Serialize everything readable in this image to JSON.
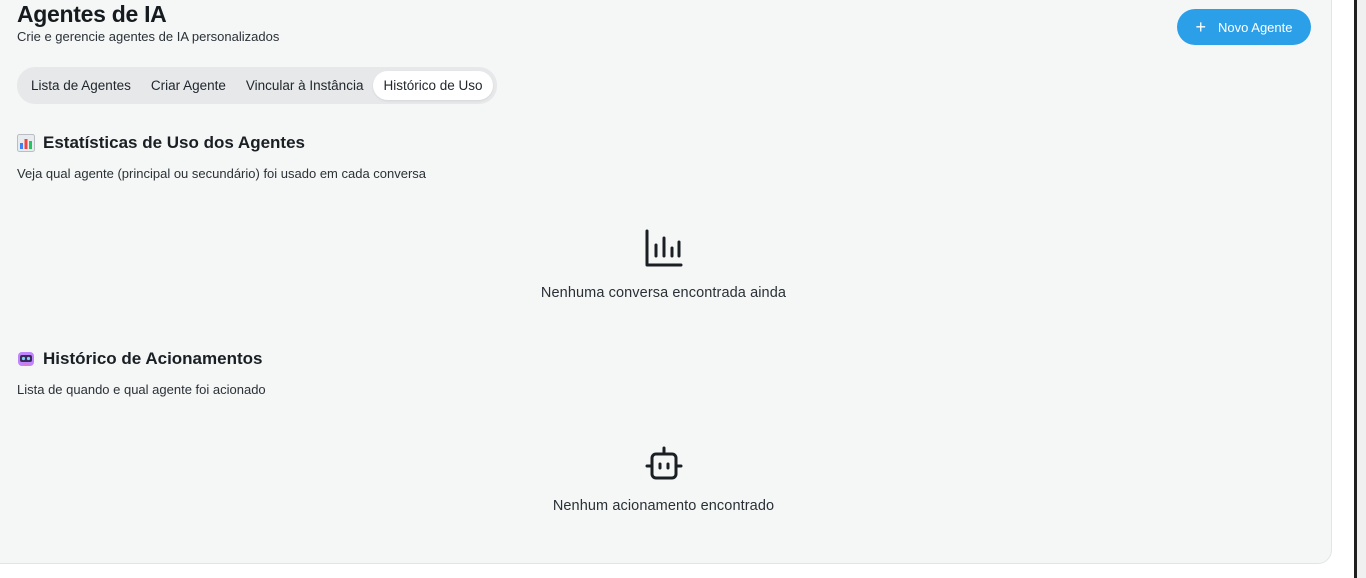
{
  "header": {
    "title": "Agentes de IA",
    "subtitle": "Crie e gerencie agentes de IA personalizados",
    "new_agent_label": "Novo Agente"
  },
  "tabs": [
    {
      "label": "Lista de Agentes",
      "active": false
    },
    {
      "label": "Criar Agente",
      "active": false
    },
    {
      "label": "Vincular à Instância",
      "active": false
    },
    {
      "label": "Histórico de Uso",
      "active": true
    }
  ],
  "usage_stats": {
    "icon": "bar-chart-emoji",
    "title": "Estatísticas de Uso dos Agentes",
    "description": "Veja qual agente (principal ou secundário) foi usado em cada conversa",
    "empty_icon": "bar-chart-icon",
    "empty_text": "Nenhuma conversa encontrada ainda"
  },
  "activation_history": {
    "icon": "robot-emoji",
    "title": "Histórico de Acionamentos",
    "description": "Lista de quando e qual agente foi acionado",
    "empty_icon": "bot-icon",
    "empty_text": "Nenhum acionamento encontrado"
  },
  "colors": {
    "accent": "#2b9fe8",
    "panel_background": "#f5f6f6",
    "tabs_background": "#e6e8ea"
  }
}
